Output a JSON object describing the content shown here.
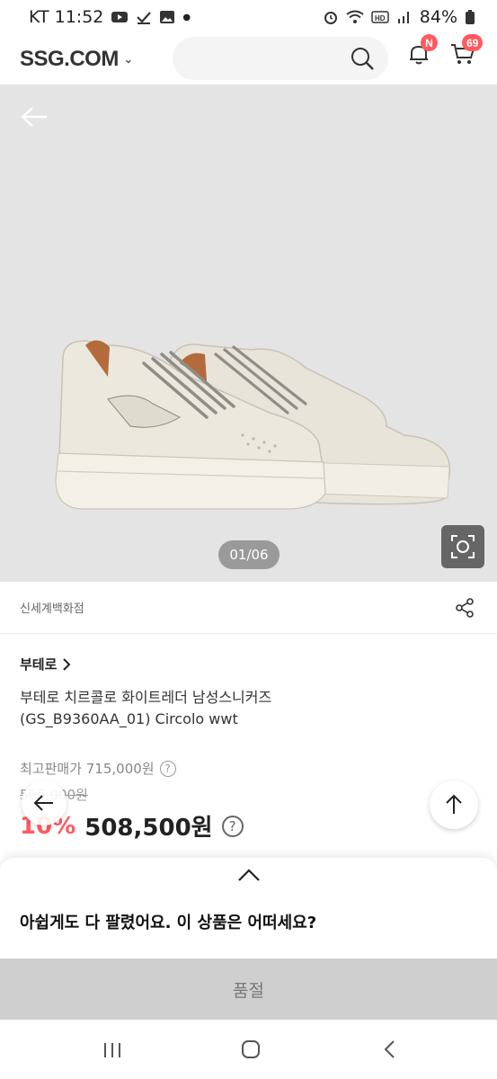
{
  "status_bar": {
    "carrier_time": "KT 11:52",
    "battery": "84%"
  },
  "header": {
    "logo": "SSG.COM",
    "notification_badge": "N",
    "cart_count": "69"
  },
  "gallery": {
    "counter": "01/06"
  },
  "store": {
    "name": "신세계백화점"
  },
  "product": {
    "brand": "부테로",
    "title_line1": "부테로 치르콜로 화이트레더 남성스니커즈",
    "title_line2": "(GS_B9360AA_01) Circolo wwt",
    "max_price_label": "최고판매가 715,000원",
    "original_price": "565,000원",
    "discount": "10%",
    "sale_price": "508,500원"
  },
  "sheet": {
    "message": "아쉽게도 다 팔렸어요. 이 상품은 어떠세요?",
    "soldout_label": "품절"
  },
  "colors": {
    "accent": "#ff5a5f",
    "hero_bg": "#e4e4e4",
    "soldout_bg": "#cfcfcf"
  }
}
